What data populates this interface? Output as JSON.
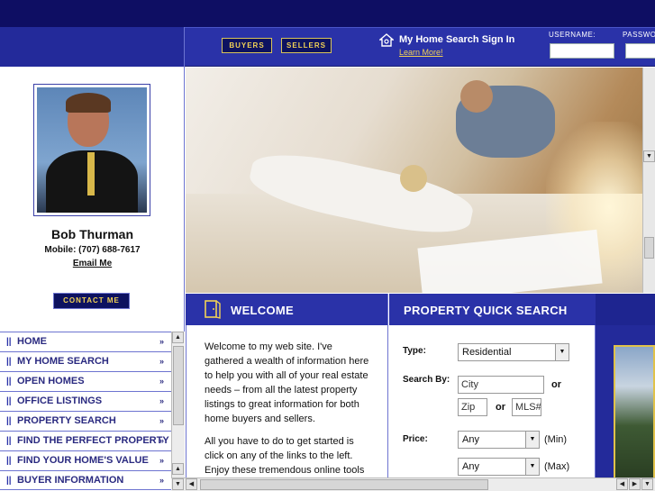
{
  "header": {
    "buyers_label": "BUYERS",
    "sellers_label": "SELLERS",
    "signin_title": "My Home Search Sign In",
    "learn_more": "Learn More!",
    "username_label": "USERNAME:",
    "password_label": "PASSWO"
  },
  "agent": {
    "name": "Bob Thurman",
    "mobile": "Mobile: (707) 688-7617",
    "email_link": "Email Me",
    "contact_button": "CONTACT ME"
  },
  "menu": {
    "items": [
      {
        "label": "HOME",
        "arrow": "»"
      },
      {
        "label": "MY HOME SEARCH",
        "arrow": "»"
      },
      {
        "label": "OPEN HOMES",
        "arrow": "»"
      },
      {
        "label": "OFFICE LISTINGS",
        "arrow": "»"
      },
      {
        "label": "PROPERTY SEARCH",
        "arrow": "»"
      },
      {
        "label": "FIND THE PERFECT PROPERTY",
        "arrow": "»"
      },
      {
        "label": "FIND YOUR HOME'S VALUE",
        "arrow": "»"
      },
      {
        "label": "BUYER INFORMATION",
        "arrow": "»"
      }
    ],
    "bullet": "||"
  },
  "welcome": {
    "title": "WELCOME",
    "p1": "Welcome to my web site. I've gathered a wealth of information here to help you with all of your real estate needs – from all the latest property listings to great information for both home buyers and sellers.",
    "p2": "All you have to do to get started is click on any of the links to the left. Enjoy these tremendous online tools"
  },
  "quick_search": {
    "title": "PROPERTY QUICK SEARCH",
    "type_label": "Type:",
    "type_value": "Residential",
    "search_by_label": "Search By:",
    "city_value": "City",
    "or1": "or",
    "zip_value": "Zip",
    "or2": "or",
    "mls_value": "MLS#",
    "price_label": "Price:",
    "min_value": "Any",
    "min_suffix": "(Min)",
    "max_value": "Any",
    "max_suffix": "(Max)"
  },
  "icons": {
    "dropdown": "▼",
    "scroll_up": "▲",
    "scroll_down": "▼",
    "scroll_left": "◀",
    "scroll_right": "▶"
  },
  "colors": {
    "navy": "#0e0e63",
    "header_blue": "#2a32a8",
    "accent_gold": "#f2d255"
  }
}
